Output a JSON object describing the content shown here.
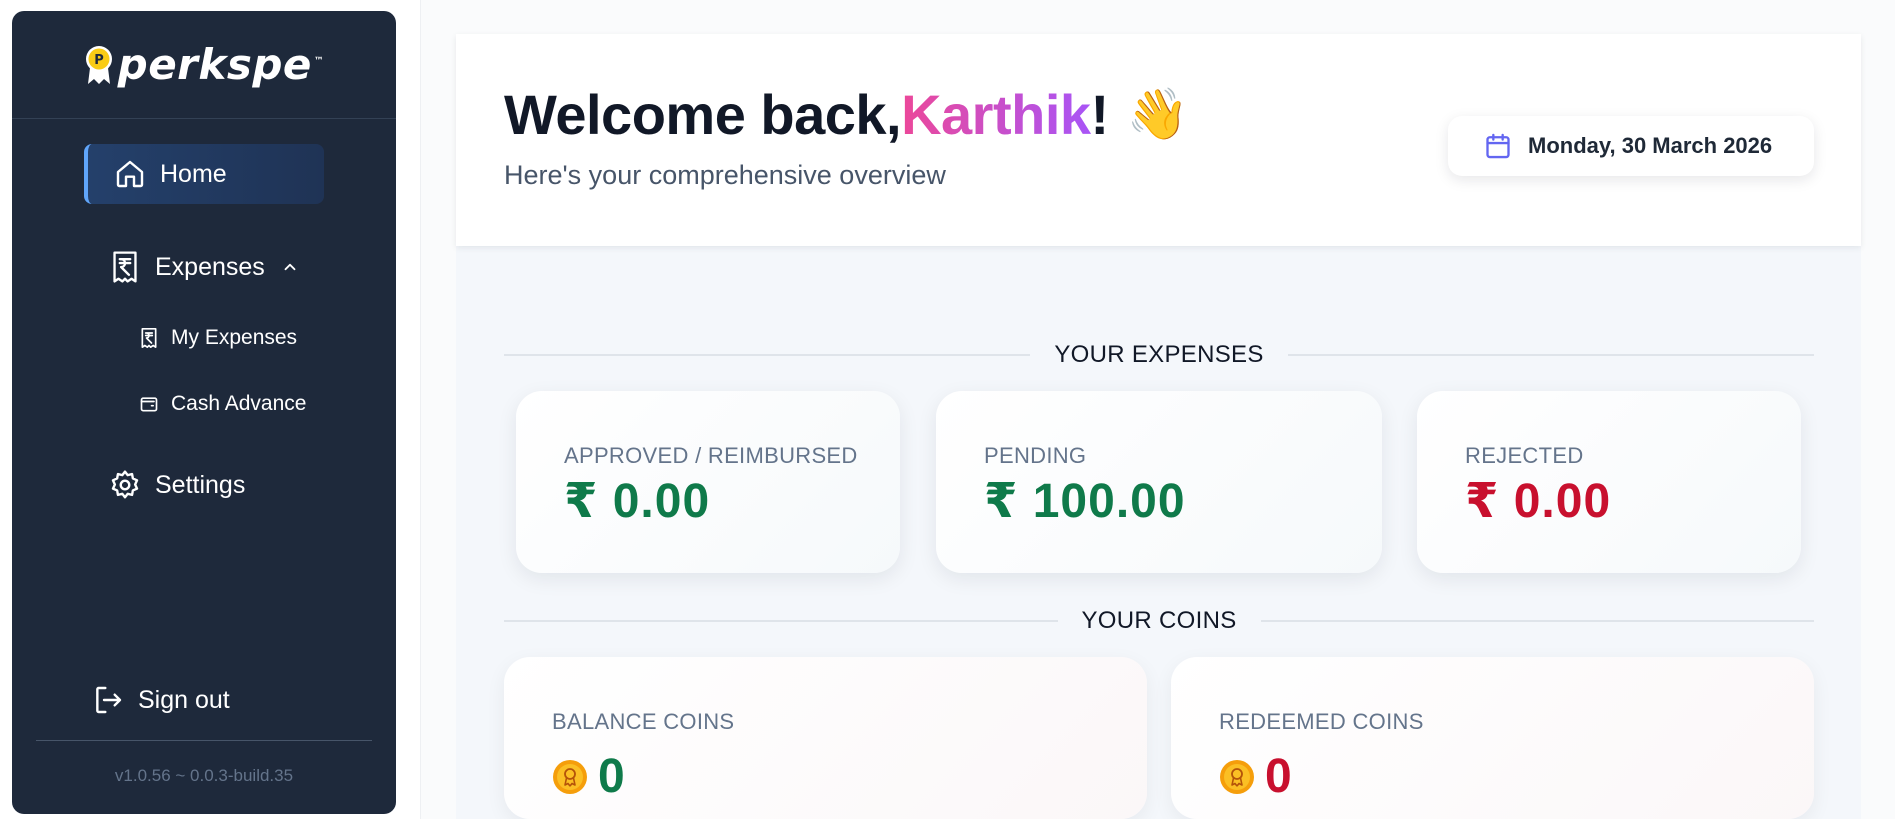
{
  "brand": {
    "name": "perkspe",
    "tm": "™",
    "logo_icon": "p-coin-badge-icon"
  },
  "sidebar": {
    "home": {
      "label": "Home",
      "icon": "home-icon"
    },
    "expenses": {
      "label": "Expenses",
      "icon": "receipt-rupee-icon",
      "expanded": true
    },
    "sub_items": [
      {
        "label": "My Expenses",
        "icon": "receipt-rupee-icon"
      },
      {
        "label": "Cash Advance",
        "icon": "wallet-icon"
      }
    ],
    "settings": {
      "label": "Settings",
      "icon": "gear-icon"
    },
    "signout": {
      "label": "Sign out",
      "icon": "logout-icon"
    },
    "version": "v1.0.56 ~ 0.0.3-build.35"
  },
  "header": {
    "welcome_prefix": "Welcome back, ",
    "user_name": "Karthik",
    "welcome_suffix": "!",
    "wave": "👋",
    "subtitle": "Here's your comprehensive overview",
    "date": "Monday, 30 March 2026"
  },
  "expenses_section": {
    "title": "YOUR EXPENSES",
    "cards": [
      {
        "caption": "APPROVED / REIMBURSED",
        "amount": "₹ 0.00",
        "color": "#0f7a4a"
      },
      {
        "caption": "PENDING",
        "amount": "₹ 100.00",
        "color": "#0f7a4a"
      },
      {
        "caption": "REJECTED",
        "amount": "₹ 0.00",
        "color": "#c8102e"
      }
    ]
  },
  "coins_section": {
    "title": "YOUR COINS",
    "cards": [
      {
        "caption": "BALANCE COINS",
        "value": "0",
        "color": "#0f7a4a"
      },
      {
        "caption": "REDEEMED COINS",
        "value": "0",
        "color": "#c8102e"
      }
    ]
  },
  "colors": {
    "sidebar_bg": "#1e293b",
    "accent_blue": "#60a5fa",
    "name_gradient_start": "#ec4899",
    "name_gradient_end": "#a855f7"
  }
}
